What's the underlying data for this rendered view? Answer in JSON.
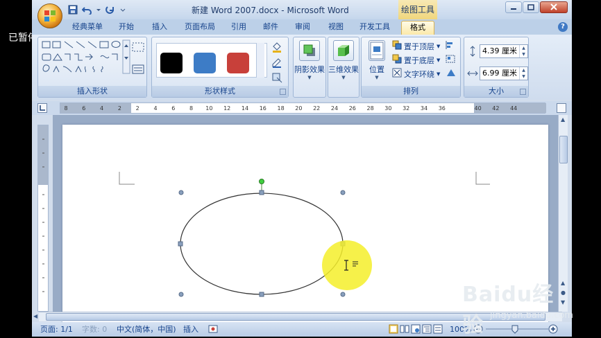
{
  "overlay": {
    "paused_label": "已暂停"
  },
  "titlebar": {
    "title": "新建 Word 2007.docx - Microsoft Word",
    "contextual_tab_title": "绘图工具"
  },
  "tabs": [
    {
      "label": "经典菜单"
    },
    {
      "label": "开始"
    },
    {
      "label": "插入"
    },
    {
      "label": "页面布局"
    },
    {
      "label": "引用"
    },
    {
      "label": "邮件"
    },
    {
      "label": "审阅"
    },
    {
      "label": "视图"
    },
    {
      "label": "开发工具"
    },
    {
      "label": "格式",
      "active": true
    }
  ],
  "ribbon": {
    "insert_shapes": {
      "label": "插入形状"
    },
    "shape_styles": {
      "label": "形状样式",
      "swatches": [
        "#000000",
        "#3d7cc6",
        "#c8403a"
      ]
    },
    "shadow_effects": {
      "label": "阴影效果"
    },
    "three_d_effects": {
      "label": "三维效果"
    },
    "arrange": {
      "label": "排列",
      "position": "位置",
      "bring_to_front": "置于顶层",
      "send_to_back": "置于底层",
      "text_wrapping": "文字环绕"
    },
    "size": {
      "label": "大小",
      "height": "4.39 厘米",
      "width": "6.99 厘米"
    }
  },
  "ruler": {
    "ticks": [
      "8",
      "6",
      "4",
      "2",
      "2",
      "4",
      "6",
      "8",
      "10",
      "12",
      "14",
      "16",
      "18",
      "20",
      "22",
      "24",
      "26",
      "28",
      "30",
      "32",
      "34",
      "36",
      "40",
      "42",
      "44"
    ]
  },
  "statusbar": {
    "page": "页面: 1/1",
    "words": "字数: 0",
    "language": "中文(简体，中国)",
    "mode": "插入",
    "zoom": "100%"
  },
  "watermark": {
    "brand": "Baidu经验",
    "url": "jingyan.baidu.com"
  },
  "colors": {
    "accent": "#15428b",
    "highlight": "#f5ef2a"
  }
}
